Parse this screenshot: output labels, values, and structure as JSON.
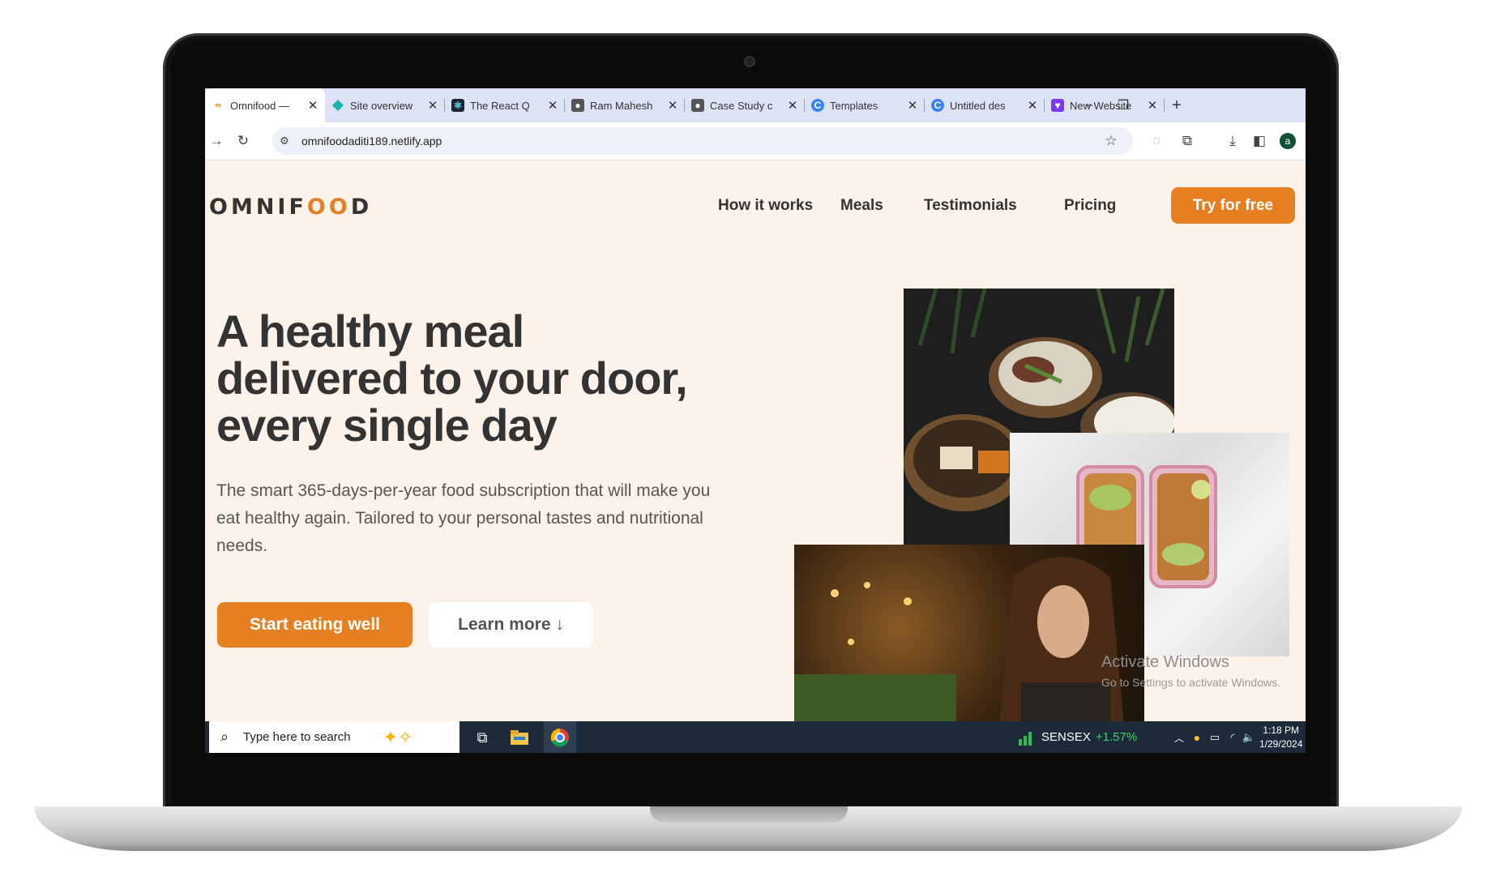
{
  "browser": {
    "tabs": [
      {
        "title": "Omnifood —",
        "active": true,
        "icon": "omnifood-icon"
      },
      {
        "title": "Site overview",
        "active": false,
        "icon": "netlify-icon"
      },
      {
        "title": "The React Q",
        "active": false,
        "icon": "react-icon"
      },
      {
        "title": "Ram Mahesh",
        "active": false,
        "icon": "person-icon"
      },
      {
        "title": "Case Study c",
        "active": false,
        "icon": "person-icon"
      },
      {
        "title": "Templates",
        "active": false,
        "icon": "canva-icon"
      },
      {
        "title": "Untitled des",
        "active": false,
        "icon": "canva-icon"
      },
      {
        "title": "New Website",
        "active": false,
        "icon": "heart-icon"
      }
    ],
    "url": "omnifoodaditi189.netlify.app",
    "profile_initial": "a"
  },
  "site": {
    "logo_pre": "OMNIF",
    "logo_oo": "OO",
    "logo_post": "D",
    "nav": {
      "how": "How it works",
      "meals": "Meals",
      "testimonials": "Testimonials",
      "pricing": "Pricing",
      "cta": "Try for free"
    },
    "hero": {
      "title_line1": "A healthy meal",
      "title_line2": "delivered to your door,",
      "title_line3": "every single day",
      "desc": "The smart 365-days-per-year food subscription that will make you eat healthy again. Tailored to your personal tastes and nutritional needs.",
      "primary_btn": "Start eating well",
      "secondary_btn": "Learn more ↓"
    }
  },
  "overlay": {
    "activate_title": "Activate Windows",
    "activate_sub": "Go to Settings to activate Windows."
  },
  "taskbar": {
    "search_placeholder": "Type here to search",
    "stock_name": "SENSEX",
    "stock_change": "+1.57%",
    "time": "1:18 PM",
    "date": "1/29/2024"
  },
  "colors": {
    "brand_orange": "#e67e22",
    "page_bg": "#fdf2e9",
    "text_dark": "#333333",
    "tab_bar": "#dde3f5",
    "taskbar": "#1d2a3a"
  }
}
